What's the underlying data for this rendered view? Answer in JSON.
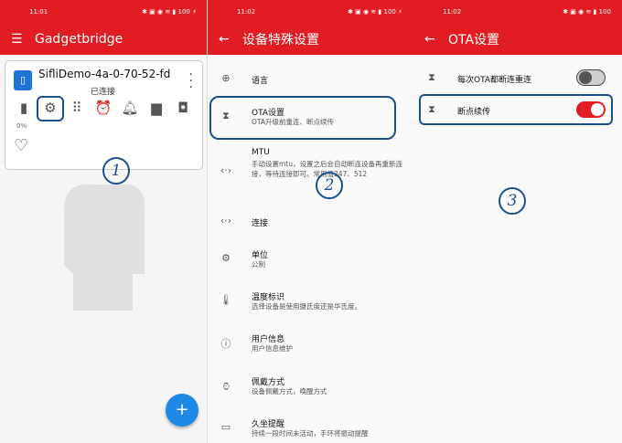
{
  "panel1": {
    "status": {
      "time": "11:01",
      "icons": "✱ ▣ ◉ ≋ ▮ 100 ⚡"
    },
    "appbar": {
      "title": "Gadgetbridge"
    },
    "device": {
      "name": "SifliDemo-4a-0-70-52-fd",
      "status": "已连接",
      "battery": "0%"
    },
    "annotation": "1"
  },
  "panel2": {
    "status": {
      "time": "11:02",
      "icons": "✱ ▣ ◉ ≋ ▮ 100 ⚡"
    },
    "appbar": {
      "title": "设备特殊设置"
    },
    "items": [
      {
        "icon": "globe-icon",
        "title": "语言",
        "subtitle": ""
      },
      {
        "icon": "hourglass-icon",
        "title": "OTA设置",
        "subtitle": "OTA升级前重连、断点续传"
      },
      {
        "icon": "code-icon",
        "title": "MTU",
        "subtitle": "手动设置mtu，设置之后会自动断连设备再重新连接，等待连接即可。常用值247、512"
      },
      {
        "icon": "code-icon",
        "title": "连接",
        "subtitle": ""
      },
      {
        "icon": "gear-icon",
        "title": "单位",
        "subtitle": "公制"
      },
      {
        "icon": "thermometer-icon",
        "title": "温度标识",
        "subtitle": "选择设备是使用摄氏度还是华氏度。"
      },
      {
        "icon": "info-icon",
        "title": "用户信息",
        "subtitle": "用户信息维护"
      },
      {
        "icon": "watch-icon",
        "title": "佩戴方式",
        "subtitle": "设备佩戴方式，唤醒方式"
      },
      {
        "icon": "sofa-icon",
        "title": "久坐提醒",
        "subtitle": "持续一段时间未活动，手环将振动提醒"
      }
    ],
    "annotation": "2"
  },
  "panel3": {
    "status": {
      "time": "11:02",
      "icons": "✱ ▣ ◉ ≋ ▮ 100"
    },
    "appbar": {
      "title": "OTA设置"
    },
    "options": [
      {
        "label": "每次OTA都断连重连",
        "on": false
      },
      {
        "label": "断点续传",
        "on": true
      }
    ],
    "annotation": "3"
  },
  "colors": {
    "accent": "#e21c23",
    "highlight": "#1d4f8f",
    "fab": "#1e88e5"
  }
}
